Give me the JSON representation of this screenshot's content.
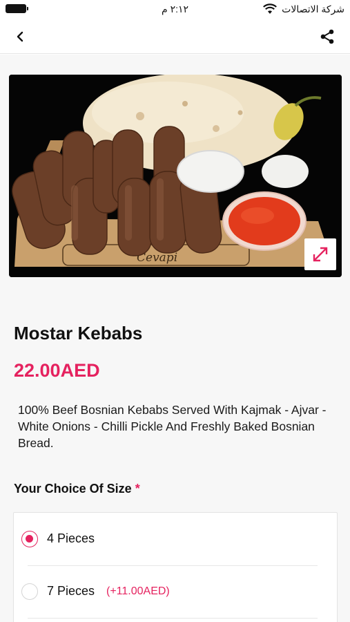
{
  "status_bar": {
    "carrier": "شركة الاتصالات",
    "time": "٢:١٢ م"
  },
  "nav": {
    "back_icon": "chevron-left-icon",
    "share_icon": "share-icon"
  },
  "product": {
    "image_brand_text": "Cevapi",
    "title": "Mostar Kebabs",
    "price": "22.00AED",
    "description": "100% Beef Bosnian Kebabs Served With Kajmak - Ajvar - White Onions - Chilli Pickle And Freshly Baked Bosnian Bread."
  },
  "size_section": {
    "label": "Your Choice Of Size",
    "required_mark": "*",
    "options": [
      {
        "label": "4 Pieces",
        "extra": "",
        "selected": true
      },
      {
        "label": "7 Pieces",
        "extra": "(+11.00AED)",
        "selected": false
      }
    ]
  },
  "colors": {
    "accent": "#e5225f",
    "text": "#111111",
    "background": "#f7f7f7"
  }
}
